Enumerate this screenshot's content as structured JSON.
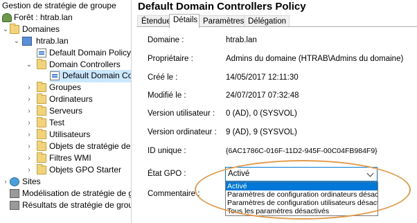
{
  "tree": {
    "title": "Gestion de stratégie de groupe",
    "forest": "Forêt : htrab.lan",
    "domaines": "Domaines",
    "domain": "htrab.lan",
    "items": [
      {
        "label": "Default Domain Policy",
        "icon": "gpo-link-icon"
      },
      {
        "label": "Domain Controllers",
        "icon": "folder-icon"
      },
      {
        "label": "Default Domain Con",
        "icon": "gpo-link-icon"
      },
      {
        "label": "Groupes",
        "icon": "folder-icon"
      },
      {
        "label": "Ordinateurs",
        "icon": "folder-icon"
      },
      {
        "label": "Serveurs",
        "icon": "folder-icon"
      },
      {
        "label": "Test",
        "icon": "folder-icon"
      },
      {
        "label": "Utilisateurs",
        "icon": "folder-icon"
      },
      {
        "label": "Objets de stratégie de g",
        "icon": "folder-icon"
      },
      {
        "label": "Filtres WMI",
        "icon": "folder-icon"
      },
      {
        "label": "Objets GPO Starter",
        "icon": "folder-icon"
      }
    ],
    "sites": "Sites",
    "modelisation": "Modélisation de stratégie de gr",
    "resultats": "Résultats de stratégie de group"
  },
  "details": {
    "title": "Default Domain Controllers Policy",
    "tabs": [
      "Étendue",
      "Détails",
      "Paramètres",
      "Délégation"
    ],
    "active_tab": "Détails",
    "props": [
      {
        "label": "Domaine :",
        "value": "htrab.lan"
      },
      {
        "label": "Propriétaire :",
        "value": "Admins du domaine (HTRAB\\Admins du domaine)"
      },
      {
        "label": "Créé le :",
        "value": "14/05/2017 12:11:30"
      },
      {
        "label": "Modifié le :",
        "value": "24/07/2017 07:32:48"
      },
      {
        "label": "Version utilisateur :",
        "value": "0 (AD), 0 (SYSVOL)"
      },
      {
        "label": "Version ordinateur :",
        "value": "9 (AD), 9 (SYSVOL)"
      },
      {
        "label": "ID unique :",
        "value": "{6AC1786C-016F-11D2-945F-00C04FB984F9}"
      }
    ],
    "etat_label": "État GPO :",
    "etat_value": "Activé",
    "commentaire_label": "Commentaire :",
    "options": [
      "Activé",
      "Paramètres de configuration ordinateurs désactiv",
      "Paramètres de configuration utilisateurs désactivé",
      "Tous les paramètres désactivés"
    ],
    "highlight_color": "#e39a4a",
    "selection_color": "#0078d7"
  }
}
